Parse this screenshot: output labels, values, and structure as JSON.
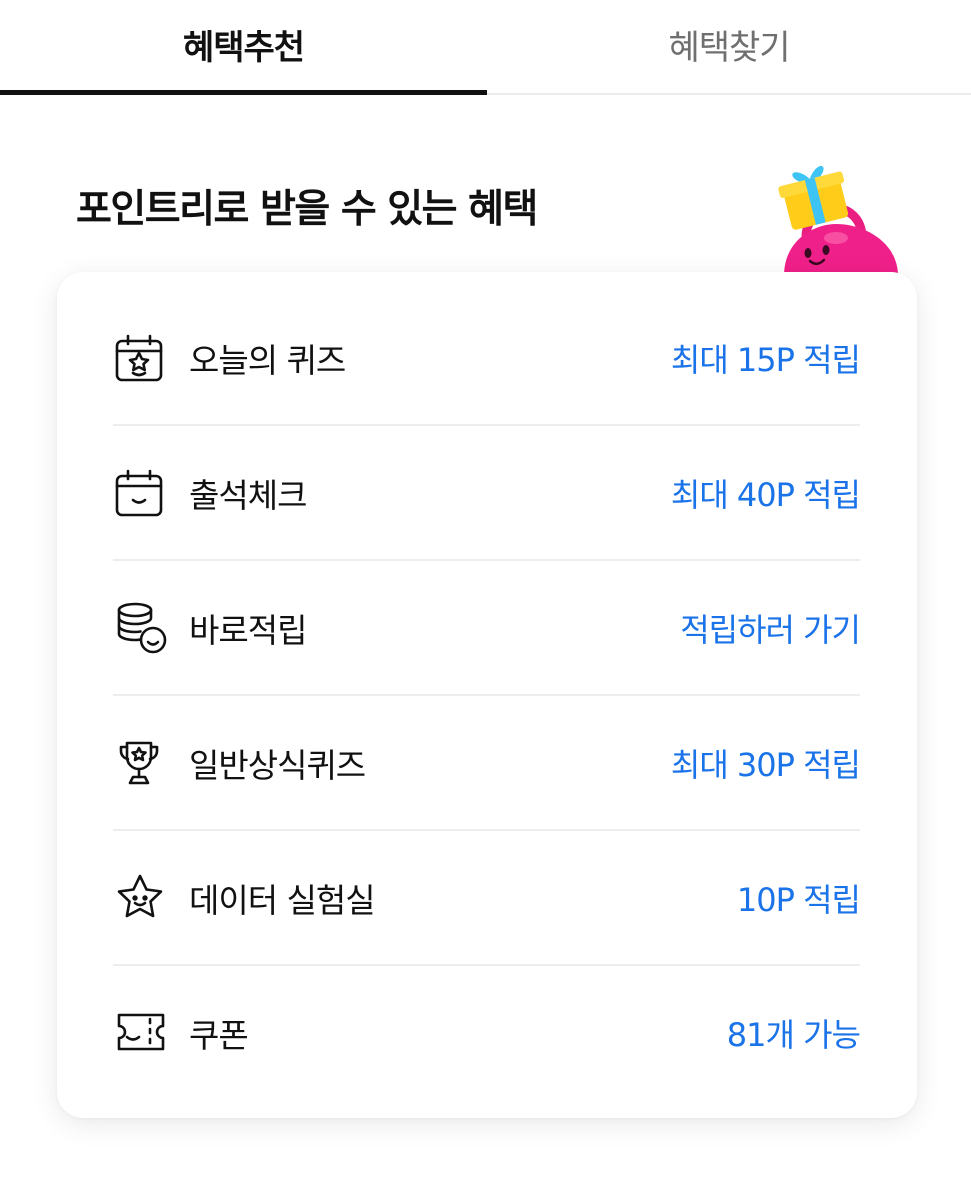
{
  "tabs": [
    {
      "label": "혜택추천",
      "active": true
    },
    {
      "label": "혜택찾기",
      "active": false
    }
  ],
  "section": {
    "title": "포인트리로 받을 수 있는 혜택"
  },
  "colors": {
    "accent": "#1a73e8",
    "text": "#111111",
    "mascot_body": "#f0208a",
    "mascot_gift": "#ffcc1a",
    "mascot_ribbon": "#3dc4f5"
  },
  "benefits": [
    {
      "icon": "quiz-calendar-icon",
      "label": "오늘의 퀴즈",
      "value": "최대 15P 적립"
    },
    {
      "icon": "attendance-calendar-icon",
      "label": "출석체크",
      "value": "최대 40P 적립"
    },
    {
      "icon": "coin-stack-icon",
      "label": "바로적립",
      "value": "적립하러 가기"
    },
    {
      "icon": "trophy-icon",
      "label": "일반상식퀴즈",
      "value": "최대 30P 적립"
    },
    {
      "icon": "star-icon",
      "label": "데이터 실험실",
      "value": "10P 적립"
    },
    {
      "icon": "coupon-icon",
      "label": "쿠폰",
      "value": "81개 가능"
    }
  ]
}
